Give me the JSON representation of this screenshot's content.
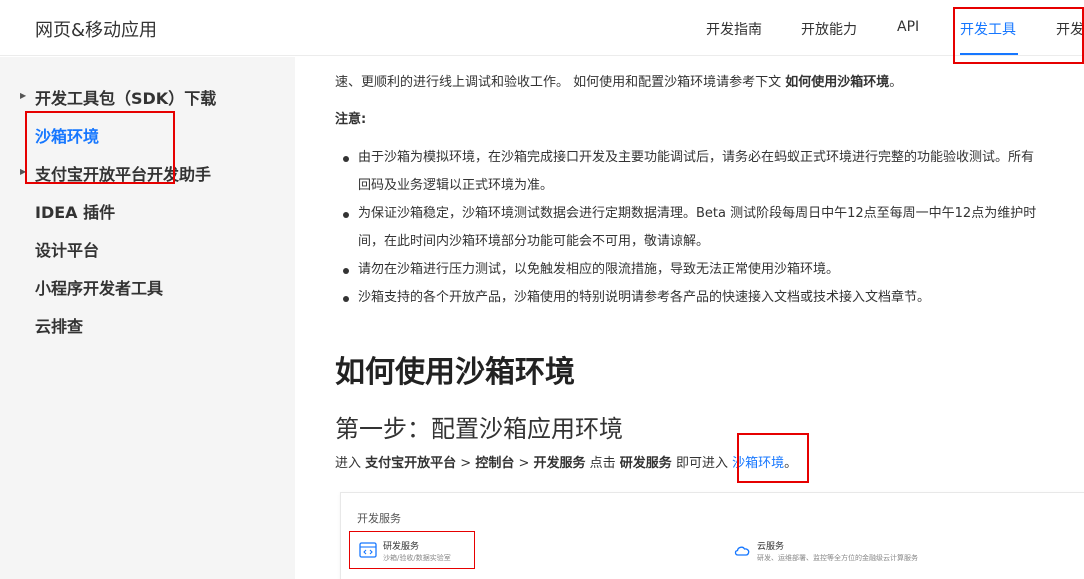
{
  "header": {
    "site_title": "网页&移动应用",
    "nav": [
      "开发指南",
      "开放能力",
      "API",
      "开发工具",
      "开发"
    ]
  },
  "sidebar": {
    "items": [
      {
        "label": "开发工具包（SDK）下载",
        "has_arrow": true
      },
      {
        "label": "沙箱环境",
        "active": true
      },
      {
        "label": "支付宝开放平台开发助手",
        "has_arrow": true
      },
      {
        "label": "IDEA 插件"
      },
      {
        "label": "设计平台"
      },
      {
        "label": "小程序开发者工具"
      },
      {
        "label": "云排查"
      }
    ]
  },
  "content": {
    "intro_line2_a": "速、更顺利的进行线上调试和验收工作。 如何使用和配置沙箱环境请参考下文 ",
    "intro_line2_b": "如何使用沙箱环境",
    "intro_line2_c": "。",
    "note_label": "注意:",
    "bullets": [
      {
        "line1": "由于沙箱为模拟环境，在沙箱完成接口开发及主要功能调试后，请务必在蚂蚁正式环境进行完整的功能验收测试。所有",
        "line2": "回码及业务逻辑以正式环境为准。"
      },
      {
        "line1": "为保证沙箱稳定，沙箱环境测试数据会进行定期数据清理。Beta 测试阶段每周日中午12点至每周一中午12点为维护时",
        "line2": "间，在此时间内沙箱环境部分功能可能会不可用，敬请谅解。"
      },
      {
        "line1": "请勿在沙箱进行压力测试，以免触发相应的限流措施，导致无法正常使用沙箱环境。"
      },
      {
        "line1": "沙箱支持的各个开放产品，沙箱使用的特别说明请参考各产品的快速接入文档或技术接入文档章节。"
      }
    ],
    "h2": "如何使用沙箱环境",
    "h3": "第一步：配置沙箱应用环境",
    "step": {
      "prefix": "进入 ",
      "b1": "支付宝开放平台",
      "sep1": " > ",
      "b2": "控制台",
      "sep2": " > ",
      "b3": "开发服务",
      "mid": " 点击 ",
      "b4": "研发服务",
      "mid2": " 即可进入 ",
      "link": "沙箱环境",
      "end": "。"
    },
    "screenshot": {
      "title": "开发服务",
      "card1_title": "研发服务",
      "card1_desc": "沙箱/验收/数据实验室",
      "card2_title": "云服务",
      "card2_desc": "研发、运维部署、监控等全方位的金融级云计算服务"
    }
  },
  "colors": {
    "accent": "#1677ff",
    "annotation": "#e60000",
    "sidebar_bg": "#f5f5f5"
  }
}
